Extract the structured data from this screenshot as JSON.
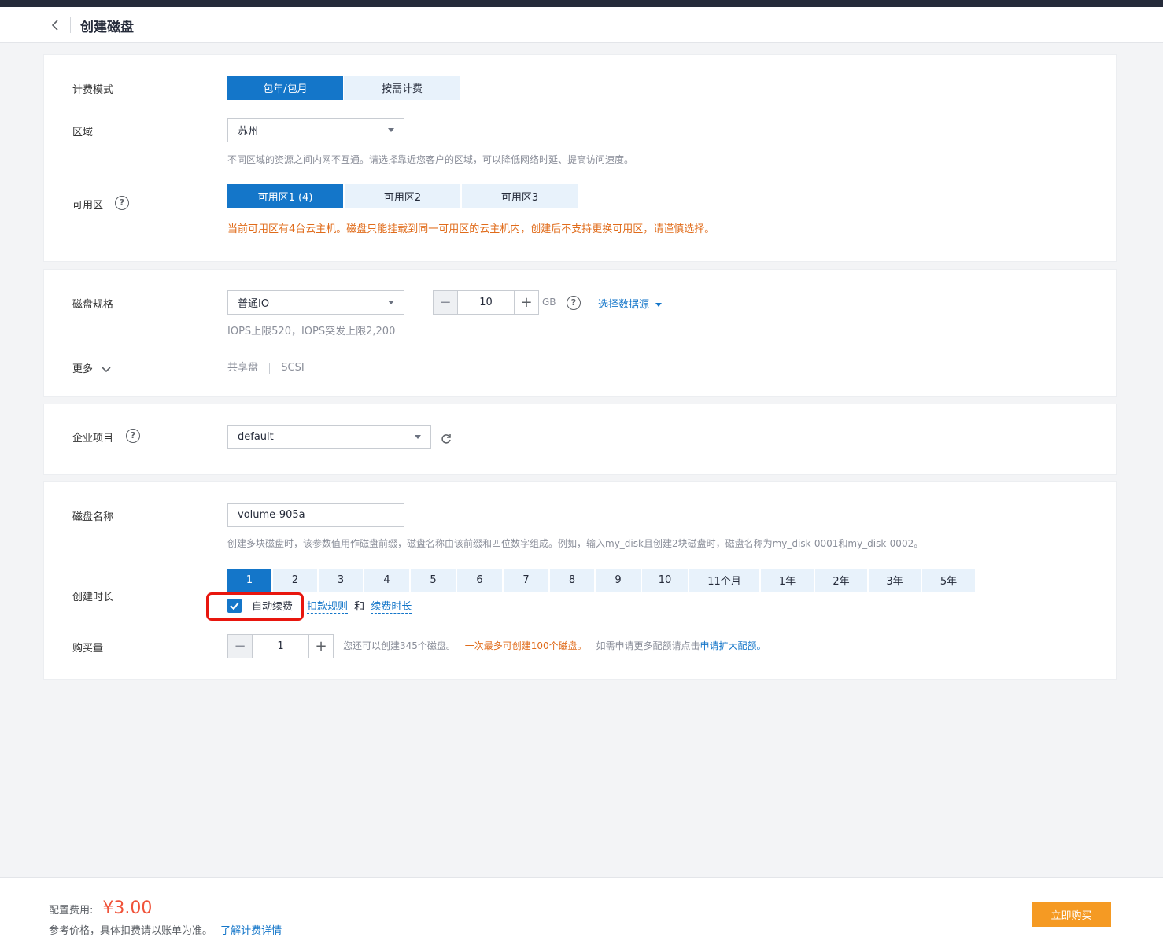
{
  "header": {
    "title": "创建磁盘"
  },
  "billing": {
    "label": "计费模式",
    "options": [
      "包年/包月",
      "按需计费"
    ]
  },
  "region": {
    "label": "区域",
    "value": "苏州",
    "hint": "不同区域的资源之间内网不互通。请选择靠近您客户的区域，可以降低网络时延、提高访问速度。"
  },
  "az": {
    "label": "可用区",
    "options": [
      "可用区1 (4)",
      "可用区2",
      "可用区3"
    ],
    "warning": "当前可用区有4台云主机。磁盘只能挂载到同一可用区的云主机内，创建后不支持更换可用区，请谨慎选择。"
  },
  "disk_spec": {
    "label": "磁盘规格",
    "type": "普通IO",
    "size": "10",
    "unit": "GB",
    "datasource": "选择数据源",
    "iops": "IOPS上限520，IOPS突发上限2,200"
  },
  "more": {
    "label": "更多",
    "items": [
      "共享盘",
      "SCSI"
    ]
  },
  "project": {
    "label": "企业项目",
    "value": "default"
  },
  "disk_name": {
    "label": "磁盘名称",
    "value": "volume-905a",
    "hint": "创建多块磁盘时，该参数值用作磁盘前缀，磁盘名称由该前缀和四位数字组成。例如，输入my_disk且创建2块磁盘时，磁盘名称为my_disk-0001和my_disk-0002。"
  },
  "duration": {
    "label": "创建时长",
    "options": [
      "1",
      "2",
      "3",
      "4",
      "5",
      "6",
      "7",
      "8",
      "9",
      "10",
      "11个月",
      "1年",
      "2年",
      "3年",
      "5年"
    ],
    "auto_renew": "自动续费",
    "rule_link": "扣款规则",
    "and": "和",
    "renew_link": "续费时长"
  },
  "quantity": {
    "label": "购买量",
    "value": "1",
    "hint1": "您还可以创建345个磁盘。",
    "hint2": "一次最多可创建100个磁盘。",
    "hint3": "如需申请更多配额请点击",
    "link": "申请扩大配额。"
  },
  "footer": {
    "fee_label": "配置费用:",
    "price": "¥3.00",
    "note": "参考价格，具体扣费请以账单为准。",
    "detail_link": "了解计费详情",
    "buy_button": "立即购买"
  },
  "colors": {
    "primary": "#1476c9",
    "warning": "#e06b1a",
    "price": "#f0533a",
    "buy": "#f59a23",
    "highlight": "#e8160e"
  }
}
